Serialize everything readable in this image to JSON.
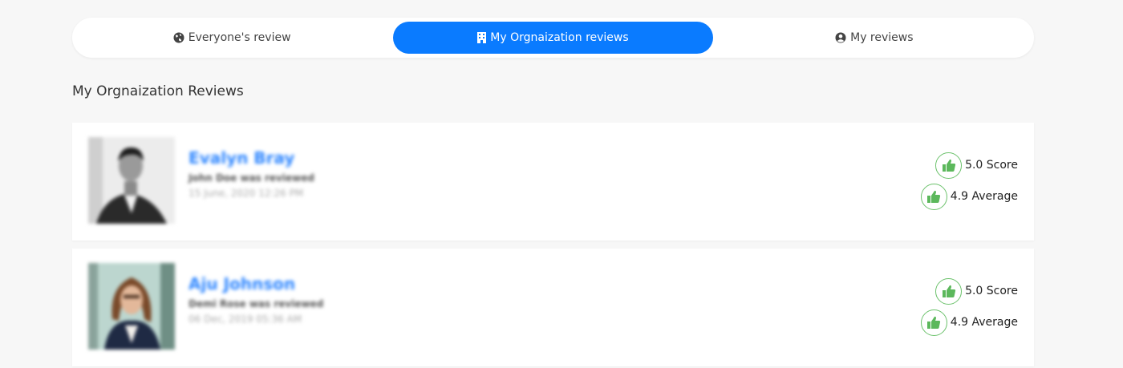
{
  "tabs": [
    {
      "label": "Everyone's review",
      "active": false,
      "icon": "globe-icon"
    },
    {
      "label": "My Orgnaization reviews",
      "active": true,
      "icon": "building-icon"
    },
    {
      "label": "My reviews",
      "active": false,
      "icon": "user-circle-icon"
    }
  ],
  "section_title": "My Orgnaization Reviews",
  "reviews": [
    {
      "name": "Evalyn Bray",
      "reviewed_text": "John Doe was reviewed",
      "date": "15 June, 2020 12:26 PM",
      "score": "5.0 Score",
      "average": "4.9 Average"
    },
    {
      "name": "Aju Johnson",
      "reviewed_text": "Demi Rose was reviewed",
      "date": "06 Dec, 2019 05:36 AM",
      "score": "5.0 Score",
      "average": "4.9 Average"
    }
  ],
  "colors": {
    "accent": "#0a7bff",
    "name_link": "#2e86ff",
    "thumb_green": "#6cc26c"
  }
}
